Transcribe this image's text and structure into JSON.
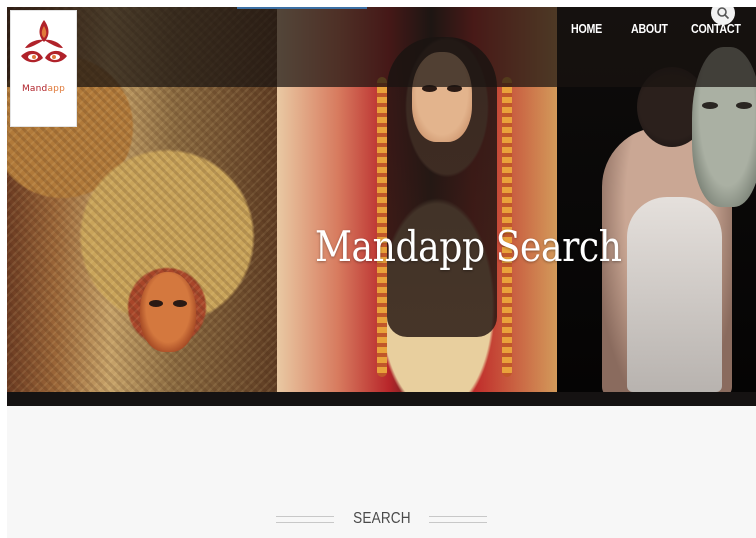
{
  "header": {
    "logo": {
      "brand_primary": "Mand",
      "brand_secondary": "app"
    },
    "nav": [
      {
        "label": "HOME"
      },
      {
        "label": "ABOUT"
      },
      {
        "label": "CONTACT"
      }
    ],
    "search_icon": "search-icon"
  },
  "hero": {
    "title": "Mandapp Search"
  },
  "section": {
    "heading": "SEARCH"
  },
  "colors": {
    "logo_red": "#b0222a",
    "logo_orange": "#e07a3a",
    "nav_text": "#ffffff",
    "section_bg": "#f7f7f7",
    "heading_text": "#4a4a4a"
  }
}
